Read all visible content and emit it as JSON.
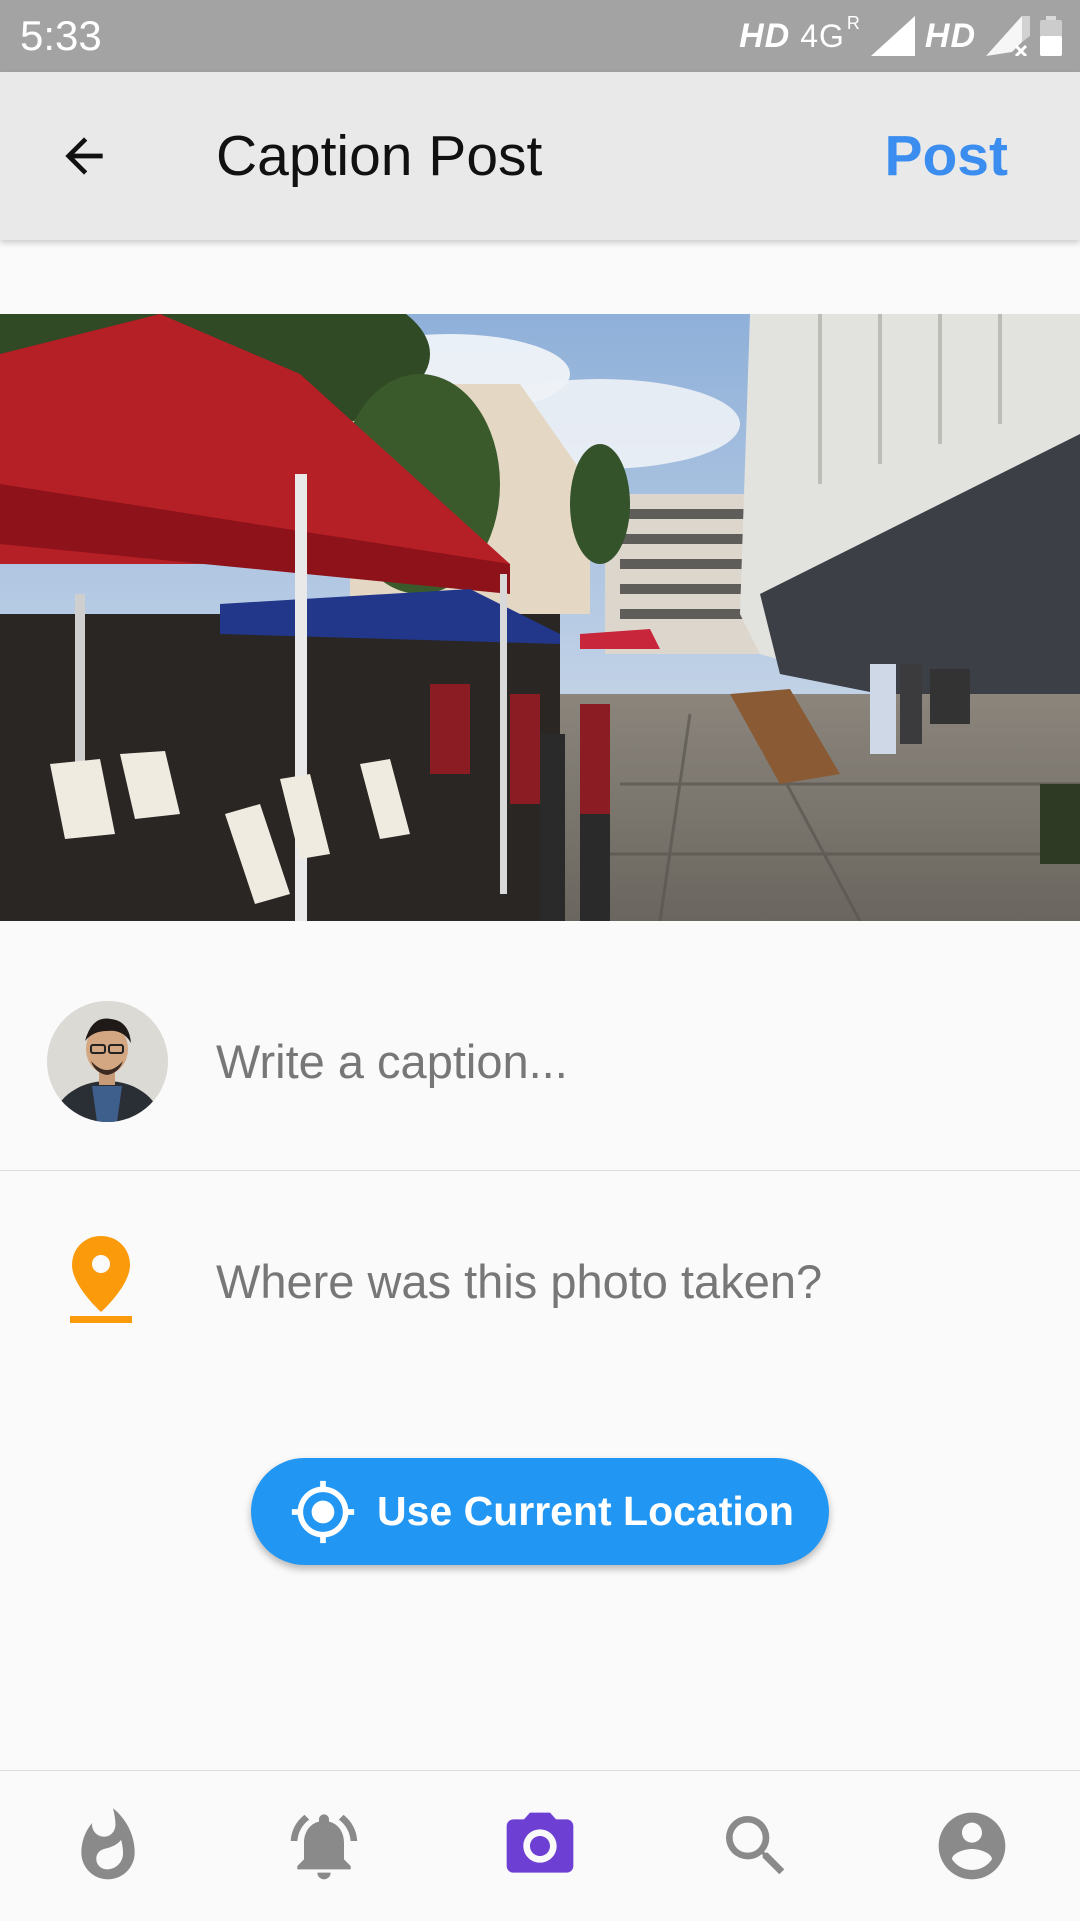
{
  "status_bar": {
    "time": "5:33",
    "network_hd_left": "HD",
    "network_4g": "4G",
    "network_roaming": "R",
    "network_hd_right": "HD"
  },
  "app_bar": {
    "title": "Caption Post",
    "post_label": "Post",
    "back_icon": "arrow-back-icon"
  },
  "caption": {
    "placeholder": "Write a caption...",
    "value": ""
  },
  "location": {
    "placeholder": "Where was this photo taken?",
    "value": "",
    "icon": "location-pin-icon"
  },
  "use_location_button": {
    "label": "Use Current Location",
    "icon": "gps-fixed-icon"
  },
  "bottom_nav": {
    "items": [
      {
        "name": "flame-icon",
        "active": false
      },
      {
        "name": "bell-icon",
        "active": false
      },
      {
        "name": "camera-icon",
        "active": true
      },
      {
        "name": "search-icon",
        "active": false
      },
      {
        "name": "account-icon",
        "active": false
      }
    ]
  },
  "colors": {
    "accent_blue": "#2196f3",
    "post_blue": "#3b8df0",
    "pin_orange": "#fb9a0b",
    "nav_active": "#6d3fd3",
    "nav_inactive": "#8a8a8a"
  }
}
